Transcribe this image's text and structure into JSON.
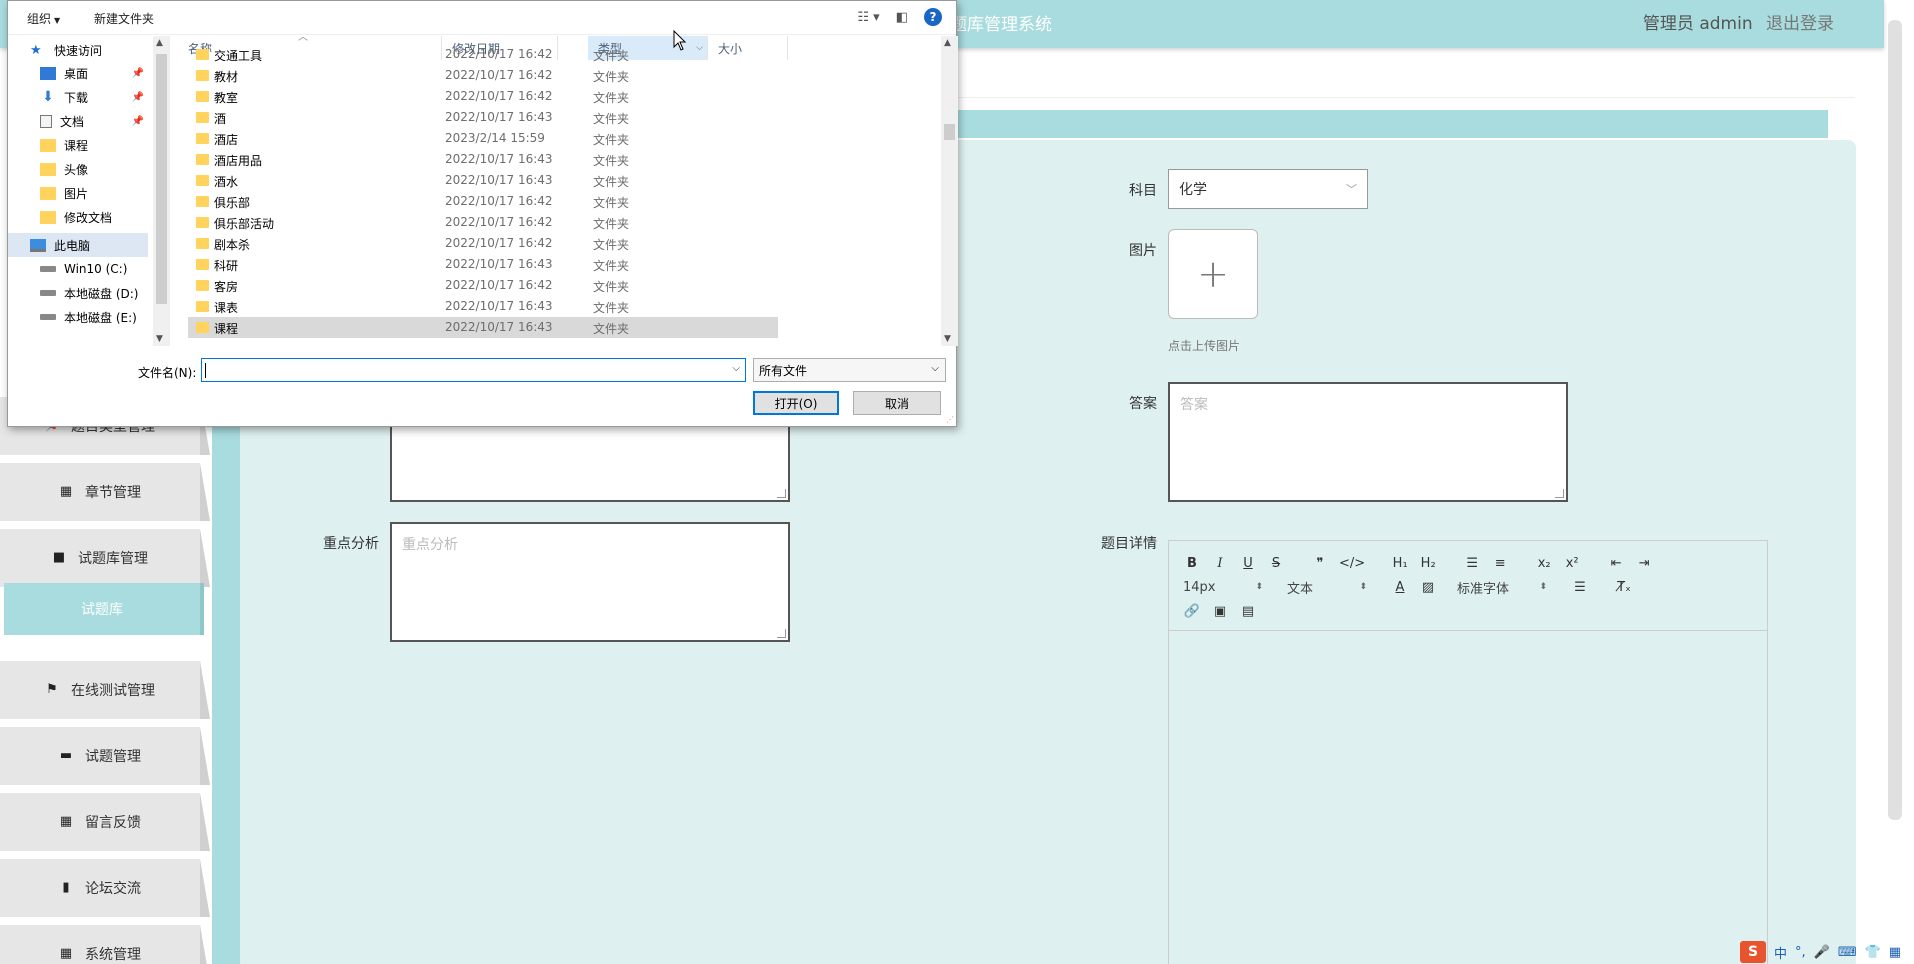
{
  "header": {
    "title": "题库管理系统",
    "user_label": "管理员 admin",
    "logout_label": "退出登录"
  },
  "sidebar": {
    "items": [
      {
        "label": "题目类型管理",
        "icon": "pin-icon"
      },
      {
        "label": "章节管理",
        "icon": "grid-icon"
      },
      {
        "label": "试题库管理",
        "icon": "video-icon"
      },
      {
        "label": "试题库",
        "icon": ""
      },
      {
        "label": "在线测试管理",
        "icon": "flag-icon"
      },
      {
        "label": "试题管理",
        "icon": "monitor-icon"
      },
      {
        "label": "留言反馈",
        "icon": "grid-icon"
      },
      {
        "label": "论坛交流",
        "icon": "clipboard-icon"
      },
      {
        "label": "系统管理",
        "icon": "grid-icon"
      }
    ],
    "active_index": 3
  },
  "form": {
    "subject_label": "科目",
    "subject_value": "化学",
    "image_label": "图片",
    "upload_hint": "点击上传图片",
    "answer_label": "答案",
    "answer_placeholder": "答案",
    "analysis_label": "重点分析",
    "analysis_placeholder": "重点分析",
    "detail_label": "题目详情"
  },
  "editor": {
    "font_size": "14px",
    "format": "文本",
    "font_family": "标准字体"
  },
  "dialog": {
    "toolbar": {
      "organize": "组织",
      "new_folder": "新建文件夹"
    },
    "nav": [
      {
        "label": "快速访问",
        "type": "star",
        "indent": 0
      },
      {
        "label": "桌面",
        "type": "desktop",
        "indent": 1,
        "pinned": true
      },
      {
        "label": "下载",
        "type": "download",
        "indent": 1,
        "pinned": true
      },
      {
        "label": "文档",
        "type": "document",
        "indent": 1,
        "pinned": true
      },
      {
        "label": "课程",
        "type": "folder",
        "indent": 1
      },
      {
        "label": "头像",
        "type": "folder",
        "indent": 1
      },
      {
        "label": "图片",
        "type": "folder",
        "indent": 1
      },
      {
        "label": "修改文档",
        "type": "folder",
        "indent": 1
      },
      {
        "label": "此电脑",
        "type": "pc",
        "indent": 0,
        "selected": true
      },
      {
        "label": "Win10 (C:)",
        "type": "disk",
        "indent": 1
      },
      {
        "label": "本地磁盘 (D:)",
        "type": "disk",
        "indent": 1
      },
      {
        "label": "本地磁盘 (E:)",
        "type": "disk",
        "indent": 1
      }
    ],
    "columns": {
      "name": "名称",
      "date": "修改日期",
      "type": "类型",
      "size": "大小"
    },
    "files": [
      {
        "name": "交通工具",
        "date": "2022/10/17 16:42",
        "type": "文件夹"
      },
      {
        "name": "教材",
        "date": "2022/10/17 16:42",
        "type": "文件夹"
      },
      {
        "name": "教室",
        "date": "2022/10/17 16:42",
        "type": "文件夹"
      },
      {
        "name": "酒",
        "date": "2022/10/17 16:43",
        "type": "文件夹"
      },
      {
        "name": "酒店",
        "date": "2023/2/14 15:59",
        "type": "文件夹"
      },
      {
        "name": "酒店用品",
        "date": "2022/10/17 16:43",
        "type": "文件夹"
      },
      {
        "name": "酒水",
        "date": "2022/10/17 16:43",
        "type": "文件夹"
      },
      {
        "name": "俱乐部",
        "date": "2022/10/17 16:42",
        "type": "文件夹"
      },
      {
        "name": "俱乐部活动",
        "date": "2022/10/17 16:42",
        "type": "文件夹"
      },
      {
        "name": "剧本杀",
        "date": "2022/10/17 16:42",
        "type": "文件夹"
      },
      {
        "name": "科研",
        "date": "2022/10/17 16:43",
        "type": "文件夹"
      },
      {
        "name": "客房",
        "date": "2022/10/17 16:42",
        "type": "文件夹"
      },
      {
        "name": "课表",
        "date": "2022/10/17 16:43",
        "type": "文件夹"
      },
      {
        "name": "课程",
        "date": "2022/10/17 16:43",
        "type": "文件夹",
        "selected": true
      }
    ],
    "filename_label": "文件名(N):",
    "filename_value": "",
    "filter_value": "所有文件",
    "open_label": "打开(O)",
    "cancel_label": "取消"
  },
  "ime": {
    "logo": "S",
    "mode": "中"
  }
}
